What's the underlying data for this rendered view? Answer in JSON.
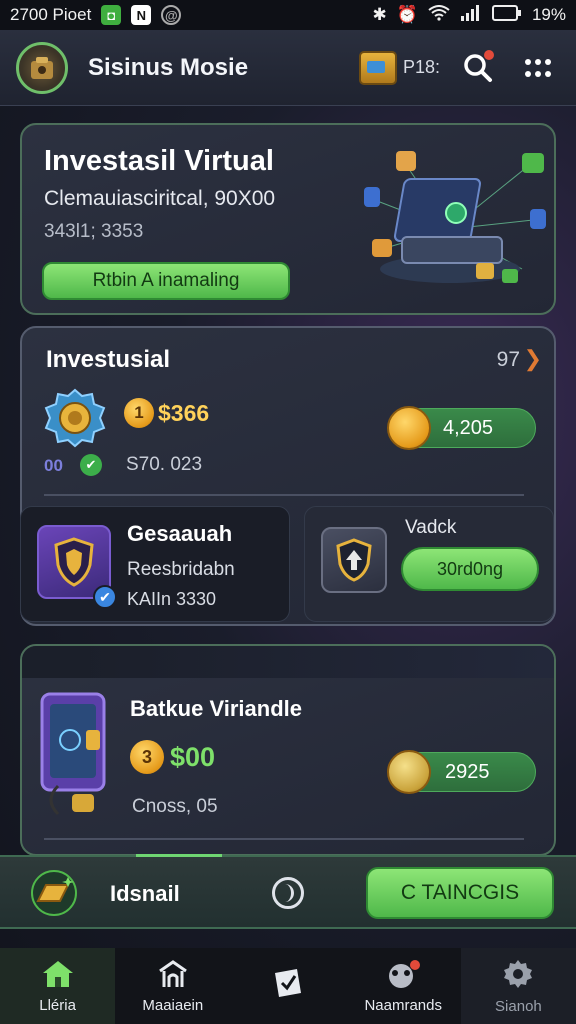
{
  "status_bar": {
    "time_text": "2700 Pioet",
    "battery_text": "19%"
  },
  "app_bar": {
    "title": "Sisinus Mosie",
    "wallet_label": "P18:"
  },
  "hero": {
    "title": "Investasil Virtual",
    "subtitle": "Clemauiasciritcal, 90X00",
    "meta": "343l1; 3353",
    "button_label": "Rtbin A inamaling"
  },
  "investments": {
    "title": "Investusial",
    "count": "97",
    "amount": "$366",
    "amount_coin_label": "1",
    "tag": "00",
    "sub_value": "S70. 023",
    "pill_value": "4,205",
    "left_panel": {
      "title": "Gesaauah",
      "subtitle": "Reesbridabn",
      "meta": "KAIIn 3330"
    },
    "right_panel": {
      "title": "Vadck",
      "button_label": "30rd0ng"
    }
  },
  "bank": {
    "title": "Batkue Viriandle",
    "coin_label": "3",
    "amount": "$00",
    "subtitle": "Cnoss, 05",
    "pill_value": "2925"
  },
  "dock": {
    "label": "Idsnail",
    "button_label": "C TAINCGIS"
  },
  "bottom_nav": [
    {
      "label": "Lléria",
      "icon": "home-icon"
    },
    {
      "label": "Maaiaein",
      "icon": "building-icon"
    },
    {
      "label": "",
      "icon": "check-card-icon"
    },
    {
      "label": "Naamrands",
      "icon": "gift-icon"
    },
    {
      "label": "Sianoh",
      "icon": "gear-icon"
    }
  ],
  "colors": {
    "accent_green": "#4fb84a",
    "gold": "#ffd25a",
    "background": "#1a1d2b"
  }
}
